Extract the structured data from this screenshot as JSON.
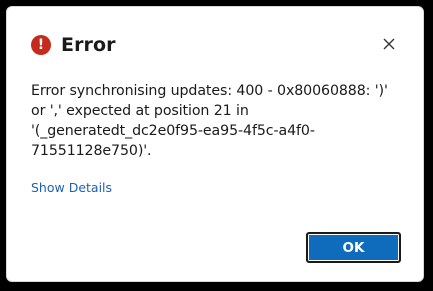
{
  "dialog": {
    "title": "Error",
    "icon": "error-icon",
    "close_icon": "close-icon",
    "message": "Error synchronising updates: 400 - 0x80060888: ')' or ',' expected at position 21 in '(_generatedt_dc2e0f95-ea95-4f5c-a4f0-71551128e750)'.",
    "show_details_label": "Show Details",
    "ok_label": "OK"
  },
  "colors": {
    "error_red": "#c42b1c",
    "accent_blue": "#0f6cbd",
    "link_blue": "#1f5fb6"
  }
}
